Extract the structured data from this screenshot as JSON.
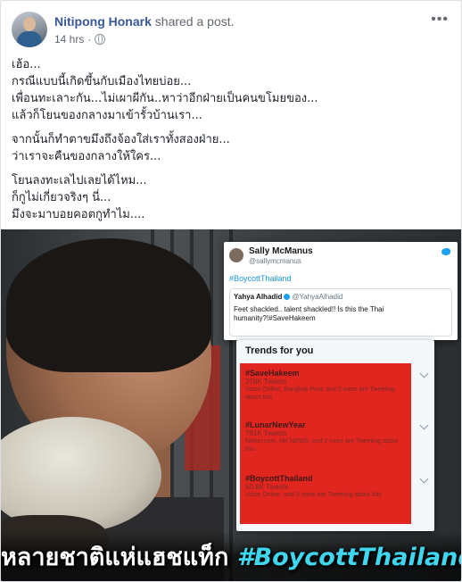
{
  "post": {
    "author": "Nitipong Honark",
    "action": "shared a post.",
    "time": "14 hrs",
    "dot": "·",
    "privacy_icon": "globe-icon",
    "more_icon": "more-options-icon",
    "more_glyph": "•••"
  },
  "text": {
    "lines_a": [
      "เฮ้อ...",
      "กรณีแบบนี้เกิดขึ้นกับเมืองไทยบ่อย...",
      "เพื่อนทะเลาะกัน...ไม่เผาผีกัน..หาว่าอีกฝ่ายเป็นคนขโมยของ...",
      "แล้วก็โยนของกลางมาเข้ารั้วบ้านเรา..."
    ],
    "lines_b": [
      "จากนั้นก็ทำตาขมึงถึงจ้องใส่เราทั้งสองฝ่าย...",
      "ว่าเราจะคืนของกลางให้ใคร..."
    ],
    "lines_c": [
      "โยนลงทะเลไปเลยได้ไหม...",
      "ก็กูไม่เกี่ยวจริงๆ นี่...",
      "มึงจะมาบอยคอตกูทำไม...."
    ]
  },
  "image": {
    "tweet": {
      "name": "Sally McManus",
      "handle": "@sallymcmanus",
      "hashtag": "#BoycottThailand",
      "quote_name": "Yahya Alhadid",
      "quote_handle": "@YahyaAlhadid",
      "quote_text": "Feet shackled.. talent shackled!! Is this the Thai humanity?!#SaveHakeem"
    },
    "trends": {
      "title": "Trends for you",
      "items": [
        {
          "tag": "#SaveHakeem",
          "count": "316K Tweets",
          "desc": "Voice Online, Bangkok Post, and 5 more are Tweeting about this"
        },
        {
          "tag": "#LunarNewYear",
          "count": "791K Tweets",
          "desc": "Nikkei.com, NK NEWS, and 2 more are Tweeting about this"
        },
        {
          "tag": "#BoycottThailand",
          "count": "50.8K Tweets",
          "desc": "Voice Online, and 3 more are Tweeting about this"
        }
      ]
    },
    "caption_thai": "หลายชาติแห่แฮชแท็ก ",
    "caption_hashtag": "#BoycottThailand"
  },
  "colors": {
    "link_blue": "#385898",
    "trend_red": "#e0261f",
    "caption_cyan": "#3fd6f0"
  }
}
